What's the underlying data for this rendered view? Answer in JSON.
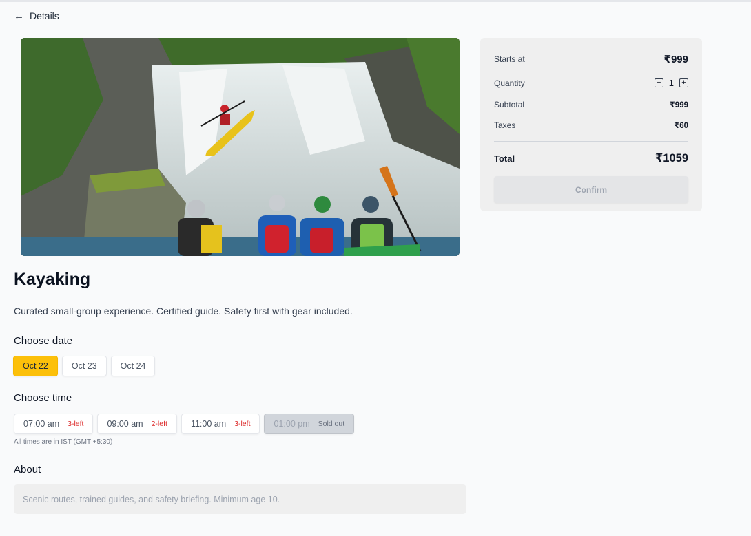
{
  "header": {
    "back_label": "Details"
  },
  "activity": {
    "title": "Kayaking",
    "description": "Curated small-group experience. Certified guide. Safety first with gear included."
  },
  "date_section": {
    "heading": "Choose date",
    "dates": [
      {
        "label": "Oct 22",
        "selected": true
      },
      {
        "label": "Oct 23",
        "selected": false
      },
      {
        "label": "Oct 24",
        "selected": false
      }
    ]
  },
  "time_section": {
    "heading": "Choose time",
    "slots": [
      {
        "time": "07:00 am",
        "availability": "3-left",
        "sold_out": false
      },
      {
        "time": "09:00 am",
        "availability": "2-left",
        "sold_out": false
      },
      {
        "time": "11:00 am",
        "availability": "3-left",
        "sold_out": false
      },
      {
        "time": "01:00 pm",
        "availability": "Sold out",
        "sold_out": true
      }
    ],
    "timezone_note": "All times are in IST (GMT +5:30)"
  },
  "about": {
    "heading": "About",
    "text": "Scenic routes, trained guides, and safety briefing. Minimum age 10."
  },
  "summary": {
    "starts_at_label": "Starts at",
    "starts_at_value": "₹999",
    "quantity_label": "Quantity",
    "quantity_value": "1",
    "minus_symbol": "−",
    "plus_symbol": "+",
    "subtotal_label": "Subtotal",
    "subtotal_value": "₹999",
    "taxes_label": "Taxes",
    "taxes_value": "₹60",
    "total_label": "Total",
    "total_value": "₹1059",
    "confirm_label": "Confirm"
  },
  "colors": {
    "accent": "#fcc00a",
    "availability": "#dc2626",
    "page_background": "#f9fafb",
    "card_background": "#efefef"
  },
  "icons": {
    "back": "arrow-left-icon"
  }
}
